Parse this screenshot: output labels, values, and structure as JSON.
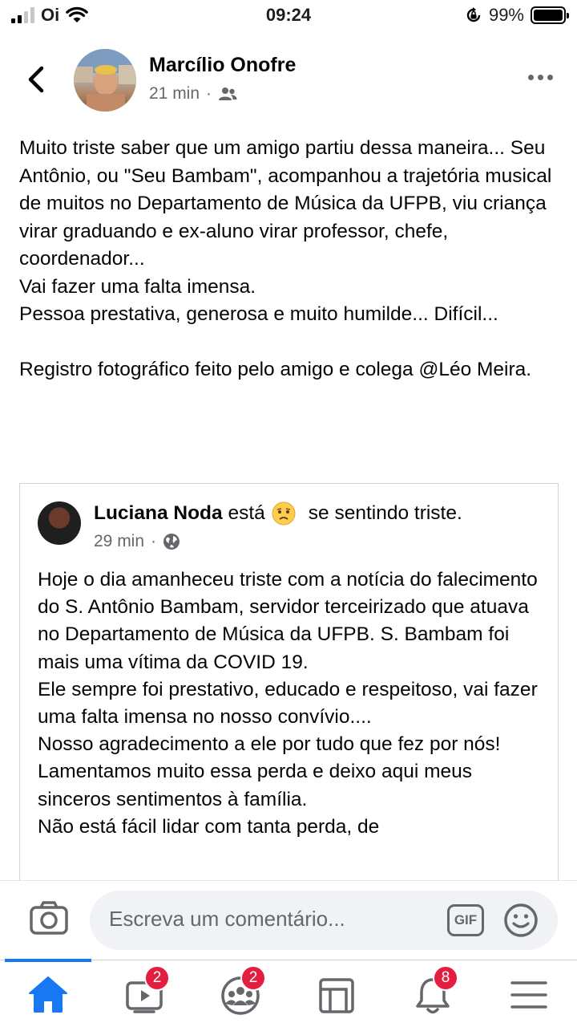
{
  "status_bar": {
    "carrier": "Oi",
    "time": "09:24",
    "battery_percent": "99%",
    "battery_level": 0.99,
    "signal_bars_active": 2
  },
  "header": {
    "author": "Marcílio Onofre",
    "time": "21 min",
    "separator": "·",
    "audience_icon": "friends-icon"
  },
  "post": {
    "text": "Muito triste saber que um amigo partiu dessa maneira... Seu Antônio, ou \"Seu Bambam\", acompanhou a trajetória musical de muitos no Departamento de Música da UFPB, viu criança virar graduando e ex-aluno virar professor, chefe, coordenador...\nVai fazer uma falta imensa.\nPessoa prestativa, generosa e muito humilde... Difícil...\n\nRegistro fotográfico feito pelo amigo e colega @Léo Meira."
  },
  "shared_post": {
    "author": "Luciana Noda",
    "feeling_prefix": "está",
    "feeling": "se sentindo triste.",
    "time": "29 min",
    "separator": "·",
    "audience_icon": "globe-icon",
    "text": "Hoje o dia amanheceu triste com a notícia do falecimento do S. Antônio Bambam, servidor terceirizado que atuava no Departamento de Música da UFPB. S. Bambam foi mais uma vítima da COVID 19.\nEle sempre foi prestativo, educado e respeitoso, vai fazer uma falta imensa no nosso convívio....\nNosso agradecimento a ele por tudo que fez por nós!\nLamentamos muito essa perda e deixo aqui meus sinceros sentimentos à família.\nNão está fácil lidar com tanta perda, de"
  },
  "comment_bar": {
    "placeholder": "Escreva um comentário...",
    "gif_label": "GIF"
  },
  "nav": {
    "items": [
      {
        "name": "home",
        "icon": "home-icon",
        "active": true
      },
      {
        "name": "watch",
        "icon": "video-icon",
        "badge": "2"
      },
      {
        "name": "groups",
        "icon": "groups-icon",
        "badge": "2"
      },
      {
        "name": "pages",
        "icon": "pages-icon"
      },
      {
        "name": "notifications",
        "icon": "bell-icon",
        "badge": "8"
      },
      {
        "name": "menu",
        "icon": "menu-icon"
      }
    ]
  },
  "colors": {
    "accent": "#1877f2",
    "badge": "#e41e3f",
    "secondary_text": "#65676b"
  }
}
